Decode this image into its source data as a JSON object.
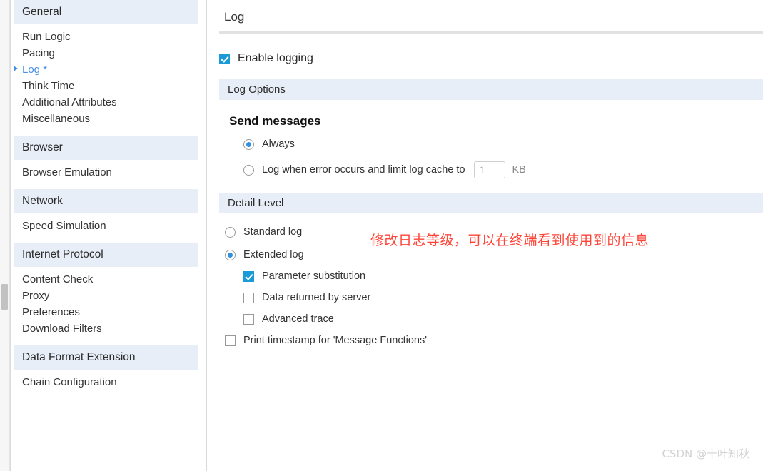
{
  "sidebar": {
    "sections": [
      {
        "header": "General",
        "items": [
          {
            "label": "Run Logic",
            "active": false
          },
          {
            "label": "Pacing",
            "active": false
          },
          {
            "label": "Log *",
            "active": true
          },
          {
            "label": "Think Time",
            "active": false
          },
          {
            "label": "Additional Attributes",
            "active": false
          },
          {
            "label": "Miscellaneous",
            "active": false
          }
        ]
      },
      {
        "header": "Browser",
        "items": [
          {
            "label": "Browser Emulation",
            "active": false
          }
        ]
      },
      {
        "header": "Network",
        "items": [
          {
            "label": "Speed Simulation",
            "active": false
          }
        ]
      },
      {
        "header": "Internet Protocol",
        "items": [
          {
            "label": "Content Check",
            "active": false
          },
          {
            "label": "Proxy",
            "active": false
          },
          {
            "label": "Preferences",
            "active": false
          },
          {
            "label": "Download Filters",
            "active": false
          }
        ]
      },
      {
        "header": "Data Format Extension",
        "items": [
          {
            "label": "Chain Configuration",
            "active": false
          }
        ]
      }
    ]
  },
  "main": {
    "page_title": "Log",
    "enable_logging": {
      "label": "Enable logging",
      "checked": true
    },
    "log_options_band": "Log Options",
    "send_messages": {
      "title": "Send messages",
      "always": {
        "label": "Always",
        "selected": true
      },
      "on_error": {
        "label": "Log when error occurs and limit log cache to",
        "selected": false,
        "cache_value": "1",
        "cache_unit": "KB"
      }
    },
    "detail_level_band": "Detail Level",
    "detail_level": {
      "standard": {
        "label": "Standard log",
        "selected": false
      },
      "extended": {
        "label": "Extended log",
        "selected": true
      },
      "extended_children": [
        {
          "label": "Parameter substitution",
          "checked": true
        },
        {
          "label": "Data returned by server",
          "checked": false
        },
        {
          "label": "Advanced trace",
          "checked": false
        }
      ],
      "print_timestamp": {
        "label": "Print timestamp for 'Message Functions'",
        "checked": false
      }
    }
  },
  "annotation": "修改日志等级，可以在终端看到使用到的信息",
  "watermark": "CSDN @十叶知秋",
  "colors": {
    "band": "#e8eef7",
    "accent_blue": "#1a9ad7",
    "radio_blue": "#2f91e0",
    "link_blue": "#4a90e2",
    "annotation_red": "#ff4437"
  }
}
